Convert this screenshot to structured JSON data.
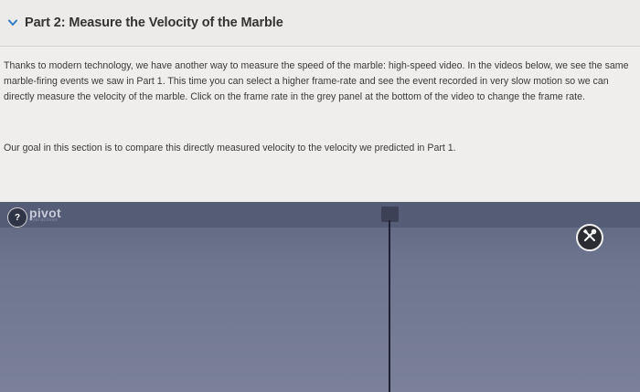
{
  "section": {
    "title": "Part 2: Measure the Velocity of the Marble",
    "paragraph1": "Thanks to modern technology, we have another way to measure the speed of the marble: high-speed video. In the videos below, we see the same marble-firing events we saw in Part 1. This time you can select a higher frame-rate and see the event recorded in very slow motion so we can directly measure the velocity of the marble. Click on the frame rate in the grey panel at the bottom of the video to change the frame rate.",
    "paragraph2": "Our goal in this section is to compare this directly measured velocity to the velocity we predicted in Part 1."
  },
  "video": {
    "logo_text": "pivot",
    "logo_subtext": "interactives",
    "help_icon_glyph": "?",
    "tools_icon": "tools-icon"
  },
  "colors": {
    "video_bg": "#6e7690",
    "video_header": "#545c76"
  }
}
